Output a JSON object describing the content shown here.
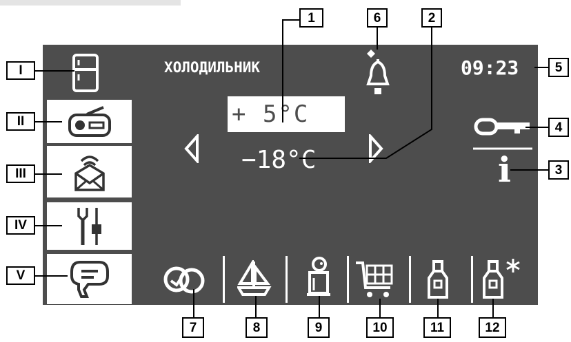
{
  "title": "ХОЛОДИЛЬНИК",
  "clock": "09:23",
  "fridge_temp": "+ 5°C",
  "freezer_temp": "−18°C",
  "info_symbol": "i",
  "sidebar_tabs": [
    {
      "numeral": "I",
      "icon": "fridge-icon"
    },
    {
      "numeral": "II",
      "icon": "radio-icon"
    },
    {
      "numeral": "III",
      "icon": "mail-icon"
    },
    {
      "numeral": "IV",
      "icon": "settings-tools-icon"
    },
    {
      "numeral": "V",
      "icon": "speech-bubble-icon"
    }
  ],
  "bottom_icons": [
    "eco-mode-icon",
    "sailboat-icon",
    "penguin-icon",
    "shopping-cart-icon",
    "bottle-icon",
    "bottle-freeze-icon"
  ],
  "callouts": {
    "c1": "1",
    "c2": "2",
    "c3": "3",
    "c4": "4",
    "c5": "5",
    "c6": "6",
    "c7": "7",
    "c8": "8",
    "c9": "9",
    "c10": "10",
    "c11": "11",
    "c12": "12",
    "r1": "I",
    "r2": "II",
    "r3": "III",
    "r4": "IV",
    "r5": "V"
  },
  "colors": {
    "screen": "#4d4d4d",
    "foreground": "#ffffff",
    "sidebar_active": "#ffffff"
  }
}
